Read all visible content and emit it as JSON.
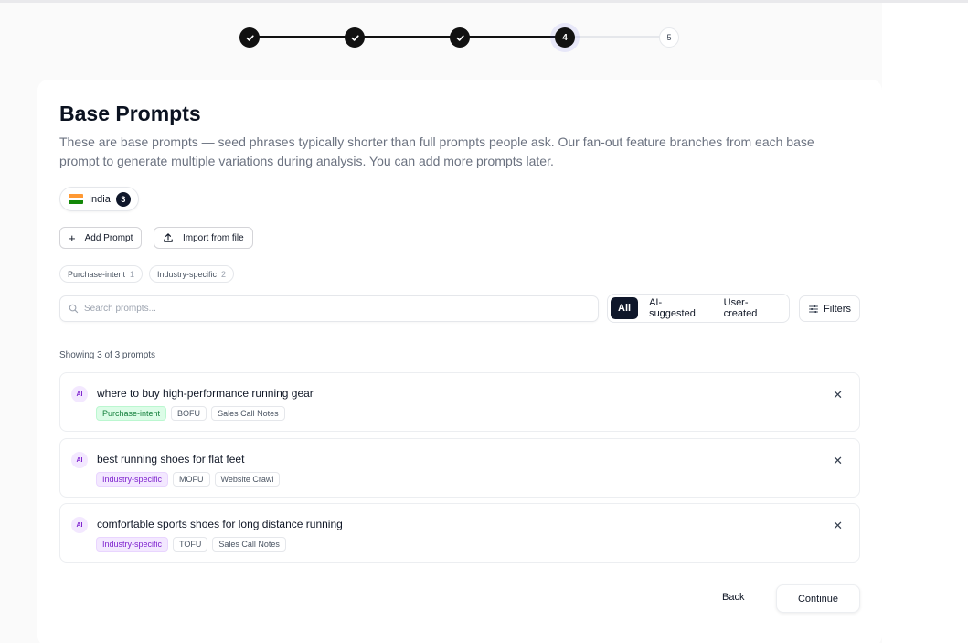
{
  "stepper": {
    "steps": [
      "✓",
      "✓",
      "✓",
      "4",
      "5"
    ]
  },
  "header": {
    "title": "Base Prompts",
    "description": "These are base prompts — seed phrases typically shorter than full prompts people ask. Our fan-out feature branches from each base prompt to generate multiple variations during analysis. You can add more prompts later."
  },
  "country": {
    "name": "India",
    "count": "3"
  },
  "actions": {
    "add_label": "Add Prompt",
    "import_label": "Import from file"
  },
  "tag_filters": [
    {
      "label": "Purchase-intent",
      "count": "1"
    },
    {
      "label": "Industry-specific",
      "count": "2"
    }
  ],
  "search": {
    "placeholder": "Search prompts..."
  },
  "segments": {
    "all": "All",
    "ai": "AI-suggested",
    "user": "User-created"
  },
  "filters_label": "Filters",
  "showing": "Showing 3 of 3 prompts",
  "prompts": [
    {
      "badge": "AI",
      "text": "where to buy high-performance running gear",
      "tags": [
        "Purchase-intent",
        "BOFU",
        "Sales Call Notes"
      ]
    },
    {
      "badge": "AI",
      "text": "best running shoes for flat feet",
      "tags": [
        "Industry-specific",
        "MOFU",
        "Website Crawl"
      ]
    },
    {
      "badge": "AI",
      "text": "comfortable sports shoes for long distance running",
      "tags": [
        "Industry-specific",
        "TOFU",
        "Sales Call Notes"
      ]
    }
  ],
  "footer": {
    "back_label": "Back",
    "continue_label": "Continue"
  },
  "colors": {
    "accent": "#0f172a",
    "green_tag": "#15803d",
    "purple_tag": "#7e22ce"
  }
}
